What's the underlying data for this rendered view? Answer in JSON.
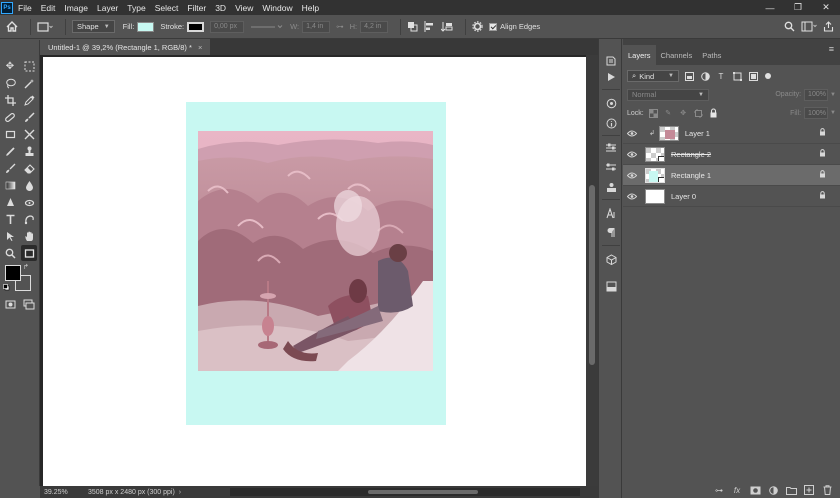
{
  "app": {
    "logo": "Ps"
  },
  "menu": [
    "File",
    "Edit",
    "Image",
    "Layer",
    "Type",
    "Select",
    "Filter",
    "3D",
    "View",
    "Window",
    "Help"
  ],
  "window_controls": {
    "minimize": "—",
    "maximize": "❐",
    "close": "✕"
  },
  "options_bar": {
    "mode": "Shape",
    "fill_label": "Fill:",
    "fill_color": "#c7f9f2",
    "stroke_label": "Stroke:",
    "stroke_color": "#000000",
    "stroke_width": "0,00 px",
    "w_label": "W:",
    "w_value": "1,4 in",
    "h_label": "H:",
    "h_value": "4,2 in",
    "align_edges_label": "Align Edges",
    "align_edges_checked": true
  },
  "document": {
    "tab_title": "Untitled-1 @ 39,2% (Rectangle 1, RGB/8) *",
    "tab_close": "×",
    "zoom": "39.25%",
    "size_info": "3508 px x 2480 px (300 ppi)",
    "polaroid_color": "#c8f8f2"
  },
  "panel": {
    "tabs": [
      "Layers",
      "Channels",
      "Paths"
    ],
    "active_tab": "Layers",
    "filter_kind": "Kind",
    "blend_mode": "Normal",
    "opacity_label": "Opacity:",
    "opacity_value": "100%",
    "lock_label": "Lock:",
    "fill_label": "Fill:",
    "fill_value": "100%",
    "layers": [
      {
        "name": "Layer 1",
        "selected": false,
        "clipped": true
      },
      {
        "name": "Rectangle 2",
        "selected": false,
        "clipped": false
      },
      {
        "name": "Rectangle 1",
        "selected": true,
        "clipped": false
      },
      {
        "name": "Layer 0",
        "selected": false,
        "clipped": false
      }
    ]
  },
  "icons": {
    "home": "⌂",
    "search": "⌕",
    "eye": "◉",
    "lock": "🔒",
    "menu": "≡"
  }
}
